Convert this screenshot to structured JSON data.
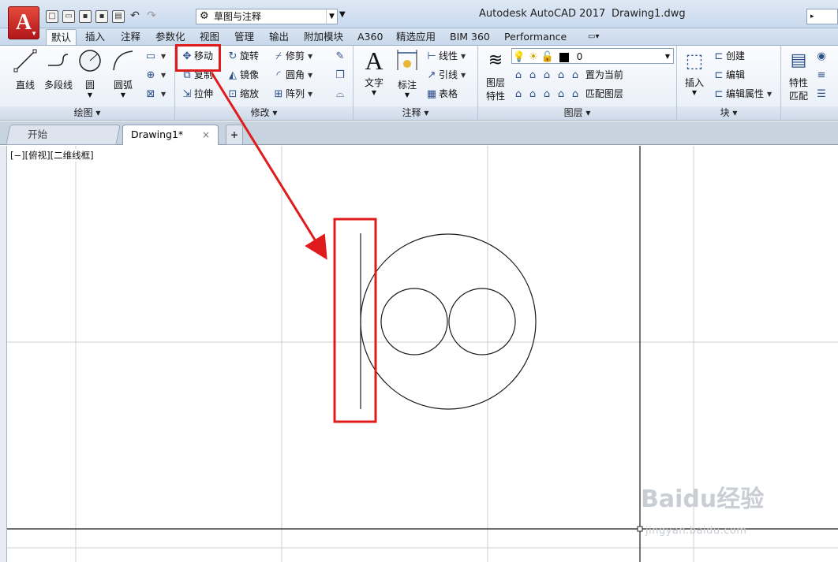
{
  "window": {
    "app_title": "Autodesk AutoCAD 2017",
    "doc_name": "Drawing1.dwg",
    "workspace": "草图与注释",
    "app_button": "A"
  },
  "ribbon_tabs": [
    "默认",
    "插入",
    "注释",
    "参数化",
    "视图",
    "管理",
    "输出",
    "附加模块",
    "A360",
    "精选应用",
    "BIM 360",
    "Performance"
  ],
  "panels": {
    "draw": {
      "title": "绘图",
      "line": "直线",
      "polyline": "多段线",
      "circle": "圆",
      "arc": "圆弧"
    },
    "modify": {
      "title": "修改",
      "move": "移动",
      "rotate": "旋转",
      "trim": "修剪",
      "copy": "复制",
      "mirror": "镜像",
      "fillet": "圆角",
      "stretch": "拉伸",
      "scale": "缩放",
      "array": "阵列"
    },
    "annotation": {
      "title": "注释",
      "text": "文字",
      "dimension": "标注",
      "linetype": "线性",
      "leader": "引线",
      "table": "表格"
    },
    "layers": {
      "title": "图层",
      "layer_props": "图层",
      "layer_props2": "特性",
      "current_layer": "0",
      "make_current": "置为当前",
      "match_layer": "匹配图层"
    },
    "block": {
      "title": "块",
      "insert": "插入",
      "create": "创建",
      "edit": "编辑",
      "edit_attr": "编辑属性"
    },
    "properties": {
      "prop1": "特性",
      "prop2": "匹配"
    }
  },
  "doc_tabs": {
    "start": "开始",
    "drawing": "Drawing1*",
    "close": "×",
    "new": "+"
  },
  "viewport_label": "[−][俯视][二维线框]",
  "watermark": {
    "main": "Baidu经验",
    "sub": "jingyan.baidu.com"
  },
  "colors": {
    "highlight": "#e01b1b",
    "arrow": "#e01b1b"
  }
}
